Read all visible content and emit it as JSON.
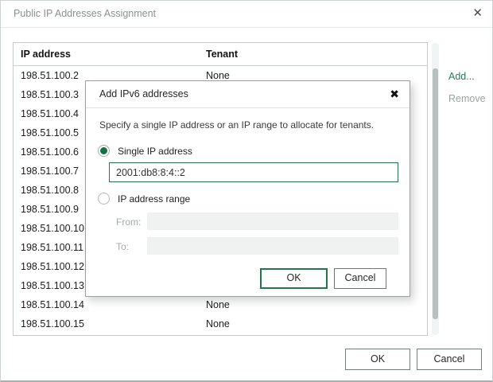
{
  "window": {
    "title": "Public IP Addresses Assignment",
    "close_icon": "✕"
  },
  "table": {
    "columns": {
      "ip": "IP address",
      "tenant": "Tenant"
    },
    "rows": [
      {
        "ip": "198.51.100.2",
        "tenant": "None"
      },
      {
        "ip": "198.51.100.3",
        "tenant": ""
      },
      {
        "ip": "198.51.100.4",
        "tenant": ""
      },
      {
        "ip": "198.51.100.5",
        "tenant": ""
      },
      {
        "ip": "198.51.100.6",
        "tenant": ""
      },
      {
        "ip": "198.51.100.7",
        "tenant": ""
      },
      {
        "ip": "198.51.100.8",
        "tenant": ""
      },
      {
        "ip": "198.51.100.9",
        "tenant": ""
      },
      {
        "ip": "198.51.100.10",
        "tenant": ""
      },
      {
        "ip": "198.51.100.11",
        "tenant": ""
      },
      {
        "ip": "198.51.100.12",
        "tenant": ""
      },
      {
        "ip": "198.51.100.13",
        "tenant": ""
      },
      {
        "ip": "198.51.100.14",
        "tenant": "None"
      },
      {
        "ip": "198.51.100.15",
        "tenant": "None"
      }
    ]
  },
  "actions": {
    "add": "Add...",
    "remove": "Remove"
  },
  "footer": {
    "ok": "OK",
    "cancel": "Cancel"
  },
  "modal": {
    "title": "Add IPv6 addresses",
    "close_icon": "✖",
    "description": "Specify a single IP address or an IP range to allocate for tenants.",
    "single_ip": {
      "label": "Single IP address",
      "value": "2001:db8:8:4::2",
      "selected": true
    },
    "range": {
      "label": "IP address range",
      "selected": false,
      "from_label": "From:",
      "from_value": "",
      "to_label": "To:",
      "to_value": ""
    },
    "ok": "OK",
    "cancel": "Cancel"
  },
  "colors": {
    "accent_green": "#1e7a4a",
    "link_green": "#1e8052",
    "disabled_text": "#9aa3a3",
    "title_text": "#8b9090",
    "row_text": "#1c1c1c"
  }
}
